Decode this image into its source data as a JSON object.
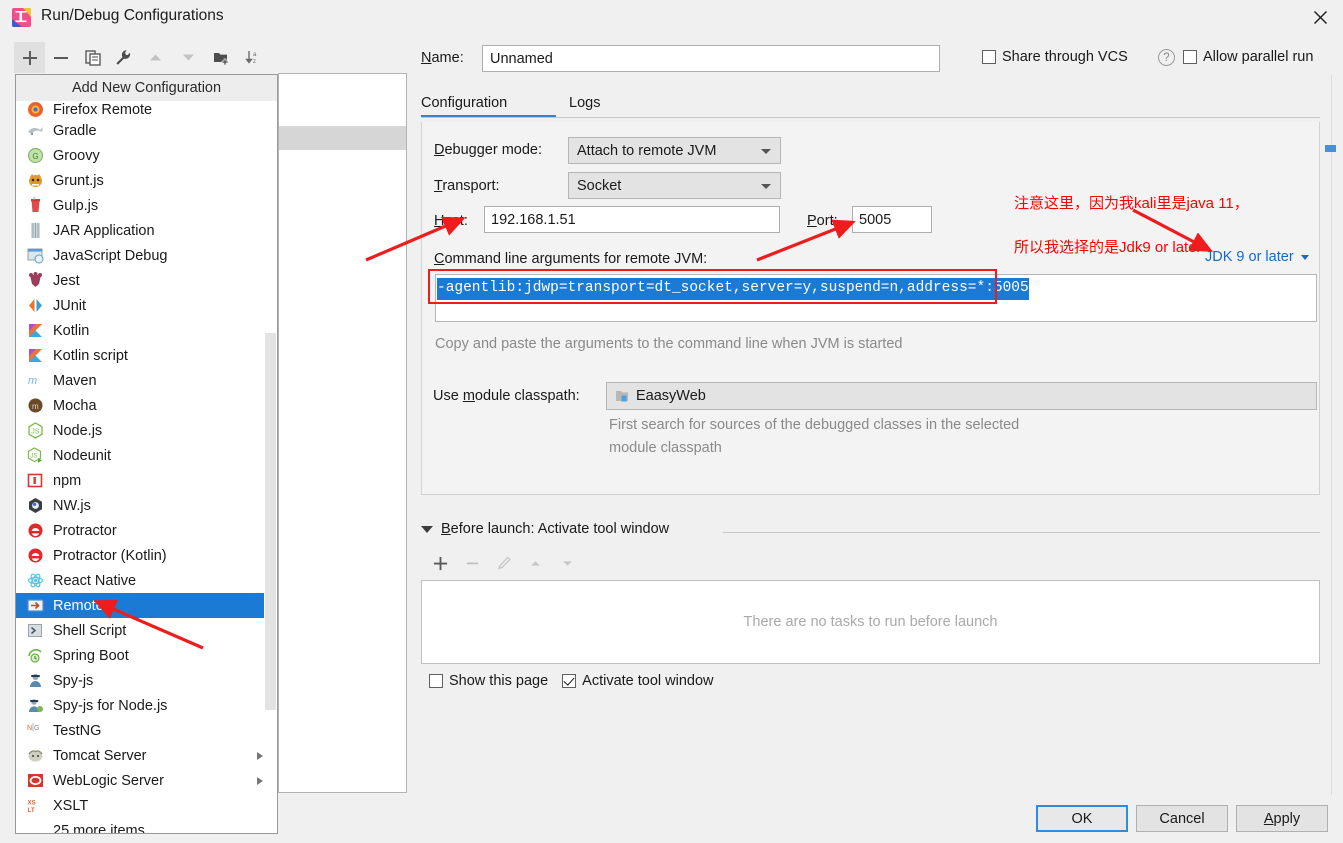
{
  "window": {
    "title": "Run/Debug Configurations",
    "close_label": "×"
  },
  "toolbar": {
    "buttons": [
      {
        "name": "add",
        "glyph": "+"
      },
      {
        "name": "remove",
        "glyph": "−"
      },
      {
        "name": "copy",
        "glyph": "copy-icon"
      },
      {
        "name": "edit-templates",
        "glyph": "wrench-icon"
      },
      {
        "name": "move-up",
        "glyph": "up-arrow-icon"
      },
      {
        "name": "move-down",
        "glyph": "down-arrow-icon"
      },
      {
        "name": "new-folder",
        "glyph": "folder-add-icon"
      },
      {
        "name": "sort",
        "glyph": "sort-az-icon"
      }
    ]
  },
  "popup": {
    "header": "Add New Configuration",
    "items": [
      {
        "label": "Firefox Remote",
        "icon": "firefox-icon",
        "clipped": true
      },
      {
        "label": "Gradle",
        "icon": "gradle-icon"
      },
      {
        "label": "Groovy",
        "icon": "groovy-icon"
      },
      {
        "label": "Grunt.js",
        "icon": "grunt-icon"
      },
      {
        "label": "Gulp.js",
        "icon": "gulp-icon"
      },
      {
        "label": "JAR Application",
        "icon": "jar-icon"
      },
      {
        "label": "JavaScript Debug",
        "icon": "javascript-debug-icon"
      },
      {
        "label": "Jest",
        "icon": "jest-icon"
      },
      {
        "label": "JUnit",
        "icon": "junit-icon"
      },
      {
        "label": "Kotlin",
        "icon": "kotlin-icon"
      },
      {
        "label": "Kotlin script",
        "icon": "kotlin-script-icon"
      },
      {
        "label": "Maven",
        "icon": "maven-icon"
      },
      {
        "label": "Mocha",
        "icon": "mocha-icon"
      },
      {
        "label": "Node.js",
        "icon": "nodejs-icon"
      },
      {
        "label": "Nodeunit",
        "icon": "nodeunit-icon"
      },
      {
        "label": "npm",
        "icon": "npm-icon"
      },
      {
        "label": "NW.js",
        "icon": "nwjs-icon"
      },
      {
        "label": "Protractor",
        "icon": "protractor-icon"
      },
      {
        "label": "Protractor (Kotlin)",
        "icon": "protractor-kotlin-icon"
      },
      {
        "label": "React Native",
        "icon": "react-native-icon"
      },
      {
        "label": "Remote",
        "icon": "remote-icon",
        "selected": true
      },
      {
        "label": "Shell Script",
        "icon": "shell-script-icon"
      },
      {
        "label": "Spring Boot",
        "icon": "spring-boot-icon"
      },
      {
        "label": "Spy-js",
        "icon": "spyjs-icon"
      },
      {
        "label": "Spy-js for Node.js",
        "icon": "spyjs-node-icon"
      },
      {
        "label": "TestNG",
        "icon": "testng-icon"
      },
      {
        "label": "Tomcat Server",
        "icon": "tomcat-icon",
        "submenu": true
      },
      {
        "label": "WebLogic Server",
        "icon": "weblogic-icon",
        "submenu": true
      },
      {
        "label": "XSLT",
        "icon": "xslt-icon"
      },
      {
        "label": "25 more items...",
        "icon": "",
        "more": true
      }
    ]
  },
  "form": {
    "name_label": "Name:",
    "name_value": "Unnamed",
    "share_vcs_label": "Share through VCS",
    "share_vcs_checked": false,
    "help_glyph": "?",
    "allow_parallel_label": "Allow parallel run",
    "allow_parallel_checked": false,
    "tabs": [
      {
        "label": "Configuration",
        "active": true
      },
      {
        "label": "Logs",
        "active": false
      }
    ],
    "debugger_mode_label": "Debugger mode:",
    "debugger_mode_value": "Attach to remote JVM",
    "transport_label": "Transport:",
    "transport_value": "Socket",
    "host_label": "Host:",
    "host_value": "192.168.1.51",
    "port_label": "Port:",
    "port_value": "5005",
    "cmd_label": "Command line arguments for remote JVM:",
    "cmd_value": "-agentlib:jdwp=transport=dt_socket,server=y,suspend=n,address=*:5005",
    "cmd_hint": "Copy and paste the arguments to the command line when JVM is started",
    "jdk_selector": "JDK 9 or later",
    "module_classpath_label": "Use module classpath:",
    "module_classpath_value": "EaasyWeb",
    "module_hint_line1": "First search for sources of the debugged classes in the selected",
    "module_hint_line2": "module classpath"
  },
  "before_launch": {
    "header": "Before launch: Activate tool window",
    "toolbar": [
      {
        "name": "add-task",
        "glyph": "+"
      },
      {
        "name": "remove-task",
        "glyph": "−"
      },
      {
        "name": "edit-task",
        "glyph": "pencil-icon"
      },
      {
        "name": "move-task-up",
        "glyph": "up-arrow-icon"
      },
      {
        "name": "move-task-down",
        "glyph": "down-arrow-icon"
      }
    ],
    "empty_text": "There are no tasks to run before launch",
    "show_page_label": "Show this page",
    "show_page_checked": false,
    "activate_tool_window_label": "Activate tool window",
    "activate_tool_window_checked": true
  },
  "dialog_buttons": {
    "ok": "OK",
    "cancel": "Cancel",
    "apply": "Apply"
  },
  "annotations": {
    "note_line1": "注意这里，因为我kali里是java 11，",
    "note_line2": "所以我选择的是Jdk9 or later",
    "color": "#ff0000"
  }
}
